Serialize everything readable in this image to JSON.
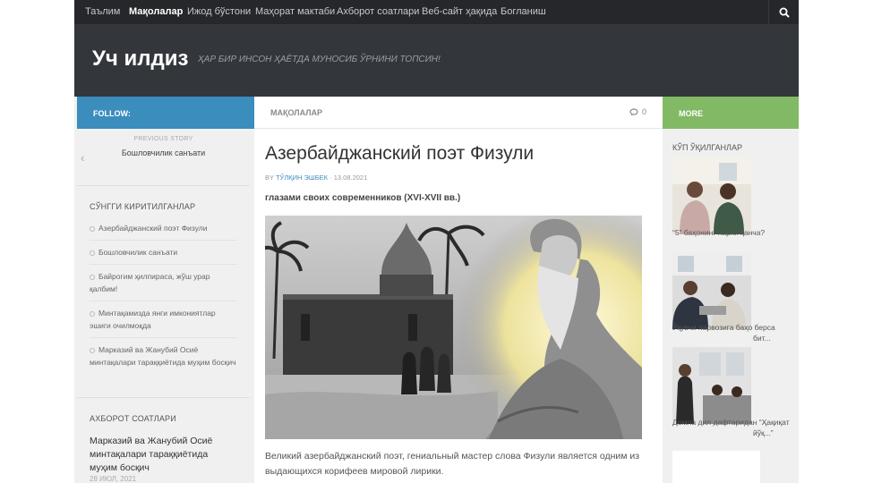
{
  "nav": {
    "items": [
      {
        "label": "Таълим",
        "active": false
      },
      {
        "label": "Мақолалар",
        "active": true
      },
      {
        "label": "Ижод бўстони",
        "active": false
      },
      {
        "label": "Маҳорат мактаби",
        "active": false
      },
      {
        "label": "Ахборот соатлари",
        "active": false
      },
      {
        "label": "Веб-сайт ҳақида",
        "active": false
      },
      {
        "label": "Богланиш",
        "active": false
      }
    ],
    "search_icon": "search-icon"
  },
  "header": {
    "site_title": "Уч илдиз",
    "tagline": "ҲАР БИР ИНСОН ҲАЁТДА МУНОСИБ ЎРНИНИ ТОПСИН!"
  },
  "bars": {
    "follow": "FOLLOW:",
    "section": "МАҚОЛАЛАР",
    "comments_count": "0",
    "more": "MORE"
  },
  "left": {
    "previous_label": "PREVIOUS STORY",
    "previous_title": "Бошловчилик санъати",
    "recent_title": "СЎНГГИ КИРИТИЛГАНЛАР",
    "recent": [
      "Азербайджанский поэт Физули",
      "Бошловчилик санъати",
      "Байрогим ҳилпираса, жўш урар қалбим!",
      "Минтақамизда янги имкониятлар эшиги очилмоқда",
      "Марказий ва Жанубий Осиё минтақалари тараққиётида муҳим босқич"
    ],
    "news_title": "АХБОРОТ СОАТЛАРИ",
    "featured_title": "Марказий ва Жанубий Осиё минтақалари тараққиётида муҳим босқич",
    "featured_date": "28 ИЮЛ, 2021"
  },
  "post": {
    "title": "Азербайджанский поэт Физули",
    "by": "BY",
    "author": "ТЎЛҚИН ЭШБЕК",
    "date": "· 13.08.2021",
    "subtitle": "глазами своих современников (XVI-XVII вв.)",
    "excerpt": "Великий азербайджанский поэт, гениальный мастер слова Физули является одним из выдающихся корифеев мировой лирики."
  },
  "right": {
    "title": "КЎП ЎҚИЛГАНЛАР",
    "popular": [
      {
        "caption": "“5” баҳонинг нархи қанча?"
      },
      {
        "caption": "Ўқувчи парвозига баҳо берса бит..."
      },
      {
        "caption": "Домла дил дафтаридан “Ҳақиқат йўқ...”"
      }
    ]
  }
}
